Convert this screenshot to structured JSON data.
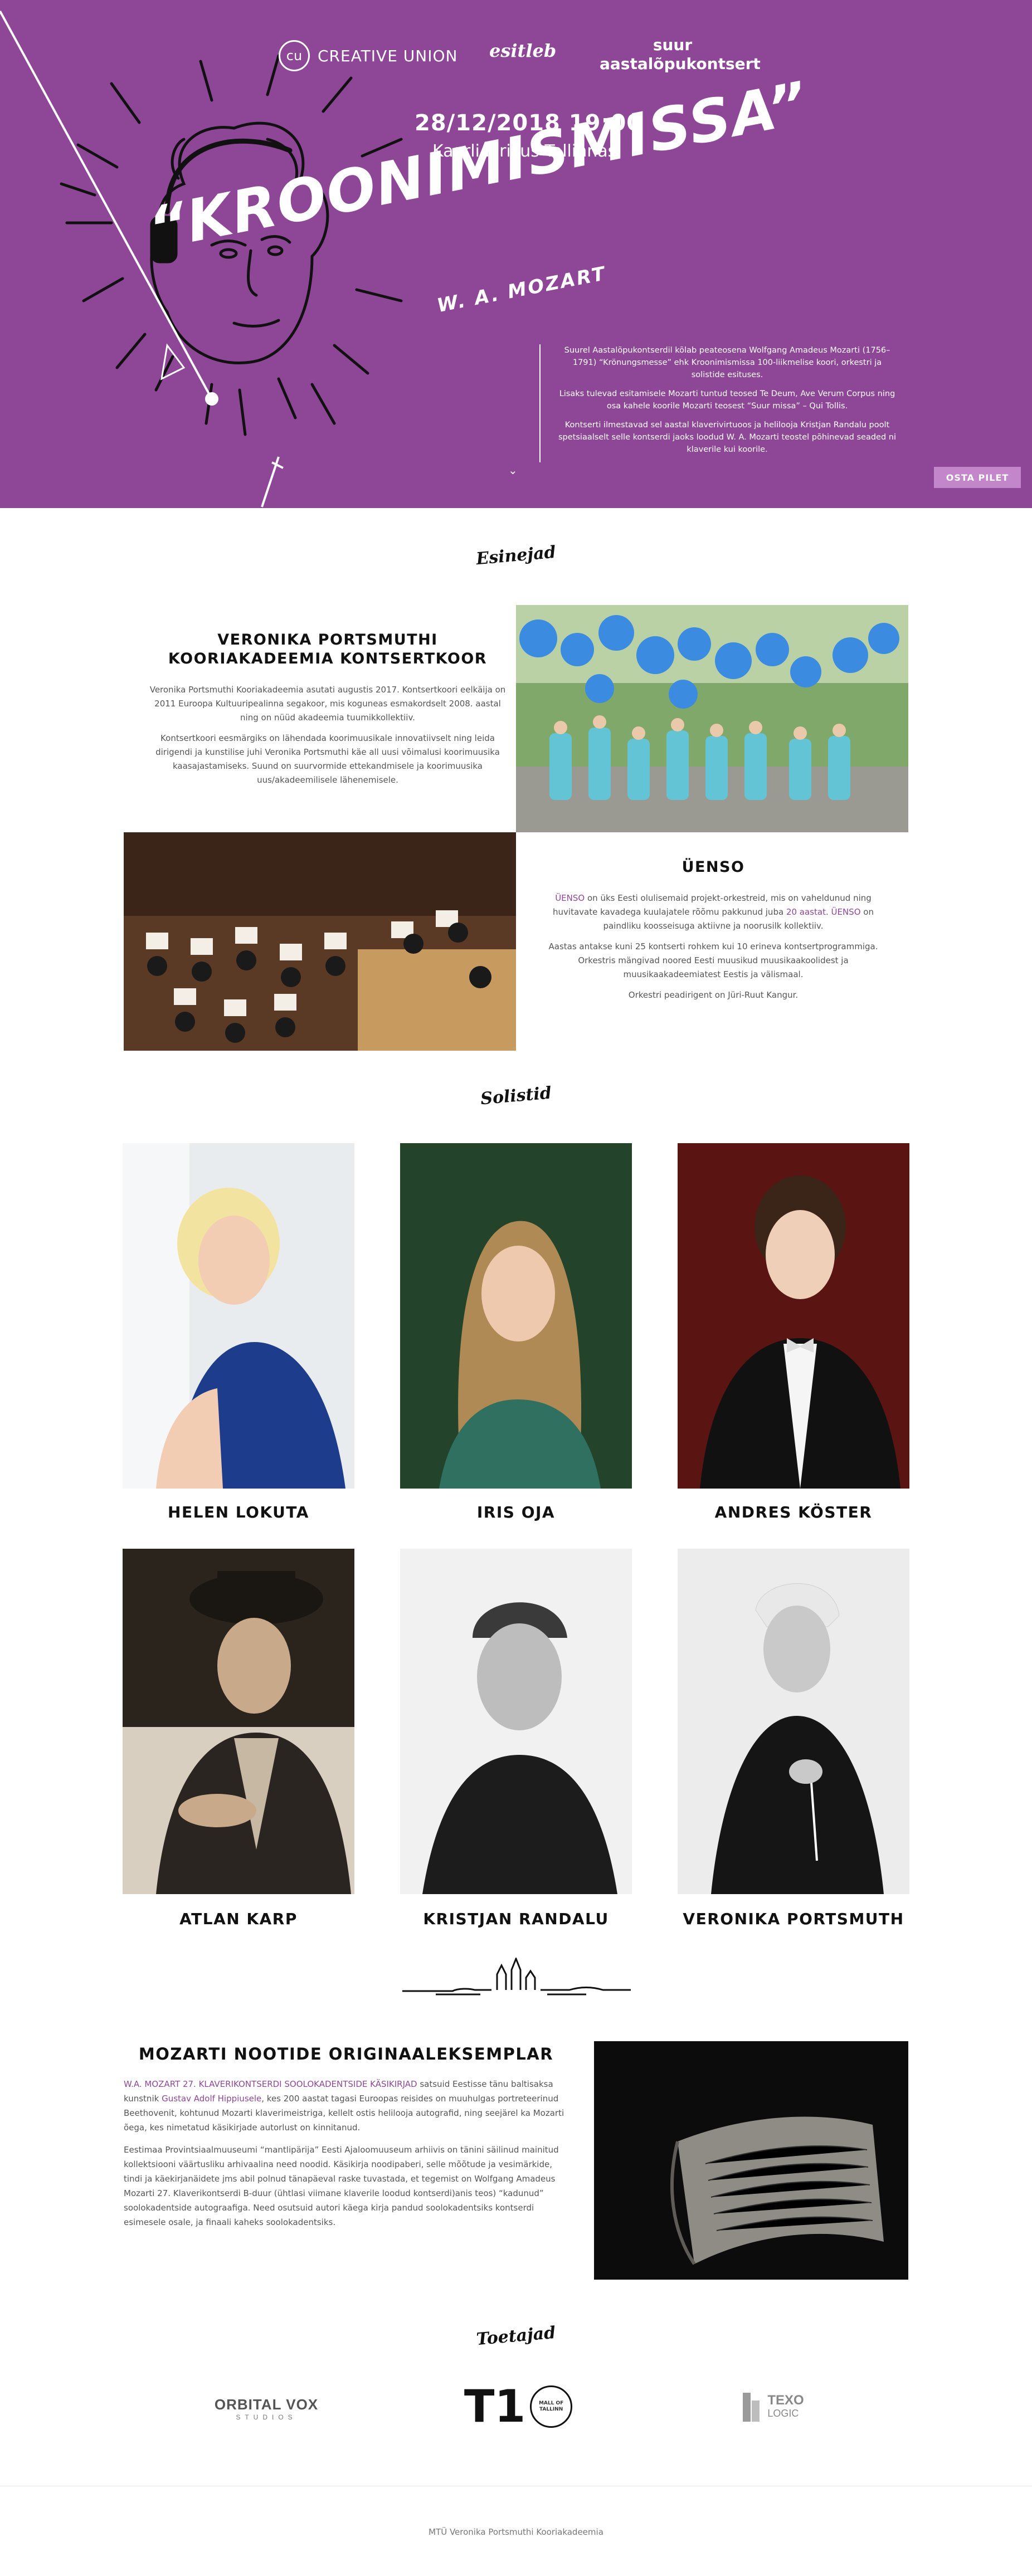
{
  "brand": {
    "logo": "cu-logo",
    "name": "CREATIVE UNION"
  },
  "hero": {
    "presents": "esitleb",
    "concert_type": "suur aastalõpukontsert",
    "date": "28/12/2018 19:00",
    "venue": "Kaarli kirikus Tallinnas",
    "title": "“KROONIMISMISSA”",
    "composer": "W. A. MOZART",
    "description": [
      "Suurel Aastalõpukontserdil kõlab peateosena Wolfgang Amadeus Mozarti (1756–1791) “Krönungsmesse” ehk Kroonimismissa 100-liikmelise koori, orkestri ja solistide esituses.",
      "Lisaks tulevad esitamisele Mozarti tuntud teosed Te Deum, Ave Verum Corpus ning osa kahele koorile Mozarti teosest “Suur missa” – Qui Tollis.",
      "Kontserti ilmestavad sel aastal klaverivirtuoos ja helilooja Kristjan Randalu poolt spetsiaalselt selle kontserdi jaoks loodud W. A. Mozarti teostel põhinevad seaded ni klaverile kui koorile."
    ],
    "scroll_icon": "chevron-down-icon",
    "buy_button": "OSTA PILET",
    "accent": "#8e4797"
  },
  "performers": {
    "heading": "Esinejad",
    "choir": {
      "title": "VERONIKA PORTSMUTHI KOORIAKADEEMIA KONTSERTKOOR",
      "paragraphs": [
        "Veronika Portsmuthi Kooriakadeemia asutati augustis 2017. Kontsertkoori eelkäija on 2011 Euroopa Kultuuripealinna segakoor, mis koguneas esmakordselt 2008. aastal ning on nüüd akadeemia tuumikkollektiiv.",
        "Kontsertkoori eesmärgiks on lähendada koorimuusikale innovatiivselt ning leida dirigendi ja kunstilise juhi Veronika Portsmuthi käe all uusi võimalusi koorimuusika kaasajastamiseks. Suund on suurvormide ettekandmisele ja koorimuusika uus/akadeemilisele lähenemisele."
      ]
    },
    "orchestra": {
      "title": "ÜENSO",
      "p1_lead": "ÜENSO",
      "p1_a": " on üks Eesti olulisemaid projekt-orkestreid, mis on vaheldunud ning huvitavate kavadega kuulajatele rõõmu pakkunud juba ",
      "p1_years": "20 aastat",
      "p1_b": ". ",
      "p1_lead2": "ÜENSO",
      "p1_c": " on paindliku koosseisuga aktiivne ja noorusilk kollektiiv.",
      "p2": "Aastas antakse kuni 25 kontserti rohkem kui 10 erineva kontsertprogrammiga. Orkestris mängivad noored Eesti muusikud muusikaakoolidest ja muusikaakadeemiatest Eestis ja välismaal.",
      "p3": "Orkestri peadirigent on Jüri-Ruut Kangur."
    }
  },
  "soloists": {
    "heading": "Solistid",
    "people": [
      {
        "name": "HELEN LOKUTA"
      },
      {
        "name": "IRIS OJA"
      },
      {
        "name": "ANDRES KÖSTER"
      },
      {
        "name": "ATLAN KARP"
      },
      {
        "name": "KRISTJAN RANDALU"
      },
      {
        "name": "VERONIKA PORTSMUTH"
      }
    ]
  },
  "manuscript": {
    "divider_icon": "tallinn-skyline-icon",
    "title": "MOZARTI NOOTIDE ORIGINAALEKSEMPLAR",
    "p1_lead": "W.A. MOZART 27. KLAVERIKONTSERDI SOOLOKADENTSIDE KÄSIKIRJAD",
    "p1_a": " satsuid Eestisse tänu baltisaksa kunstnik ",
    "p1_link": "Gustav Adolf  Hippiusele",
    "p1_b": ", kes 200 aastat tagasi Euroopas reisides on muuhulgas portreteerinud Beethovenit, kohtunud Mozarti klaverimeistriga, kellelt ostis helilooja autografid, ning seejärel ka Mozarti õega, kes nimetatud käsikirjade autorlust on kinnitanud.",
    "p2": "Eestimaa Provintsiaalmuuseumi “mantlipärija” Eesti Ajaloomuuseum arhiivis on tänini säilinud mainitud kollektsiooni väärtusliku arhivaalina need noodid. Käsikirja noodipaberi, selle mõõtude ja vesimärkide, tindi ja käekirjanäidete jms abil polnud tänapäeval raske tuvastada, et tegemist on Wolfgang Amadeus Mozarti 27. Klaverikontserdi B-duur (ühtlasi viimane klaverile loodud kontserdi)anis teos) “kadunud” soolokadentside autograafiga. Need osutsuid autori käega kirja pandud soolokadentsiks kontserdi esimesele osale, ja finaali kaheks soolokadentsiks."
  },
  "sponsors": {
    "heading": "Toetajad",
    "items": [
      {
        "name": "ORBITAL VOX",
        "sub": "STUDIOS"
      },
      {
        "name": "T1",
        "sub": "MALL OF TALLINN"
      },
      {
        "name": "TEXO",
        "sub": "LOGIC"
      }
    ]
  },
  "footer": {
    "text": "MTÜ Veronika Portsmuthi Kooriakadeemia"
  }
}
